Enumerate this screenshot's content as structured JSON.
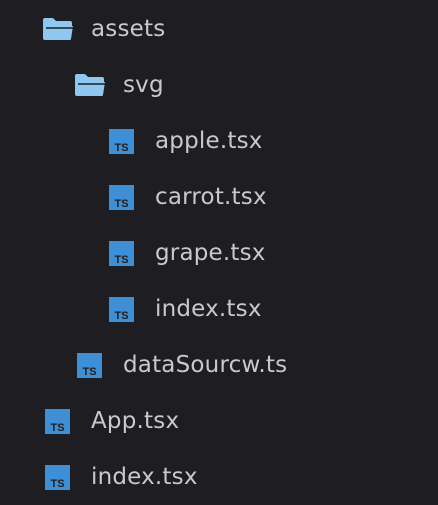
{
  "explorer": {
    "items": [
      {
        "label": "assets",
        "icon": "folder-open-icon",
        "kind": "folder",
        "depth": 0
      },
      {
        "label": "svg",
        "icon": "folder-open-icon",
        "kind": "folder",
        "depth": 1
      },
      {
        "label": "apple.tsx",
        "icon": "typescript-file-icon",
        "kind": "file",
        "depth": 2
      },
      {
        "label": "carrot.tsx",
        "icon": "typescript-file-icon",
        "kind": "file",
        "depth": 2
      },
      {
        "label": "grape.tsx",
        "icon": "typescript-file-icon",
        "kind": "file",
        "depth": 2
      },
      {
        "label": "index.tsx",
        "icon": "typescript-file-icon",
        "kind": "file",
        "depth": 2
      },
      {
        "label": "dataSourcw.ts",
        "icon": "typescript-file-icon",
        "kind": "file",
        "depth": 1
      },
      {
        "label": "App.tsx",
        "icon": "typescript-file-icon",
        "kind": "file",
        "depth": 0
      },
      {
        "label": "index.tsx",
        "icon": "typescript-file-icon",
        "kind": "file",
        "depth": 0
      }
    ]
  },
  "colors": {
    "background": "#1e1e22",
    "folder": "#8ec7ef",
    "ts_badge": "#3f8fd6",
    "text": "#c8c8ce"
  }
}
